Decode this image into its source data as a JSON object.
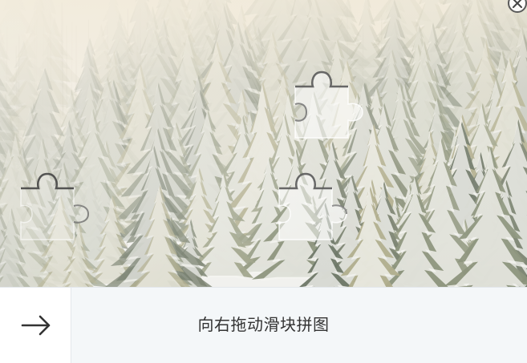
{
  "captcha": {
    "hint_text": "向右拖动滑块拼图",
    "handle_icon": "arrow-right-icon",
    "close_icon": "close-icon"
  },
  "colors": {
    "track_bg": "#f4f7f9",
    "handle_bg": "#ffffff",
    "hint_text": "#333333",
    "arrow": "#333333"
  }
}
